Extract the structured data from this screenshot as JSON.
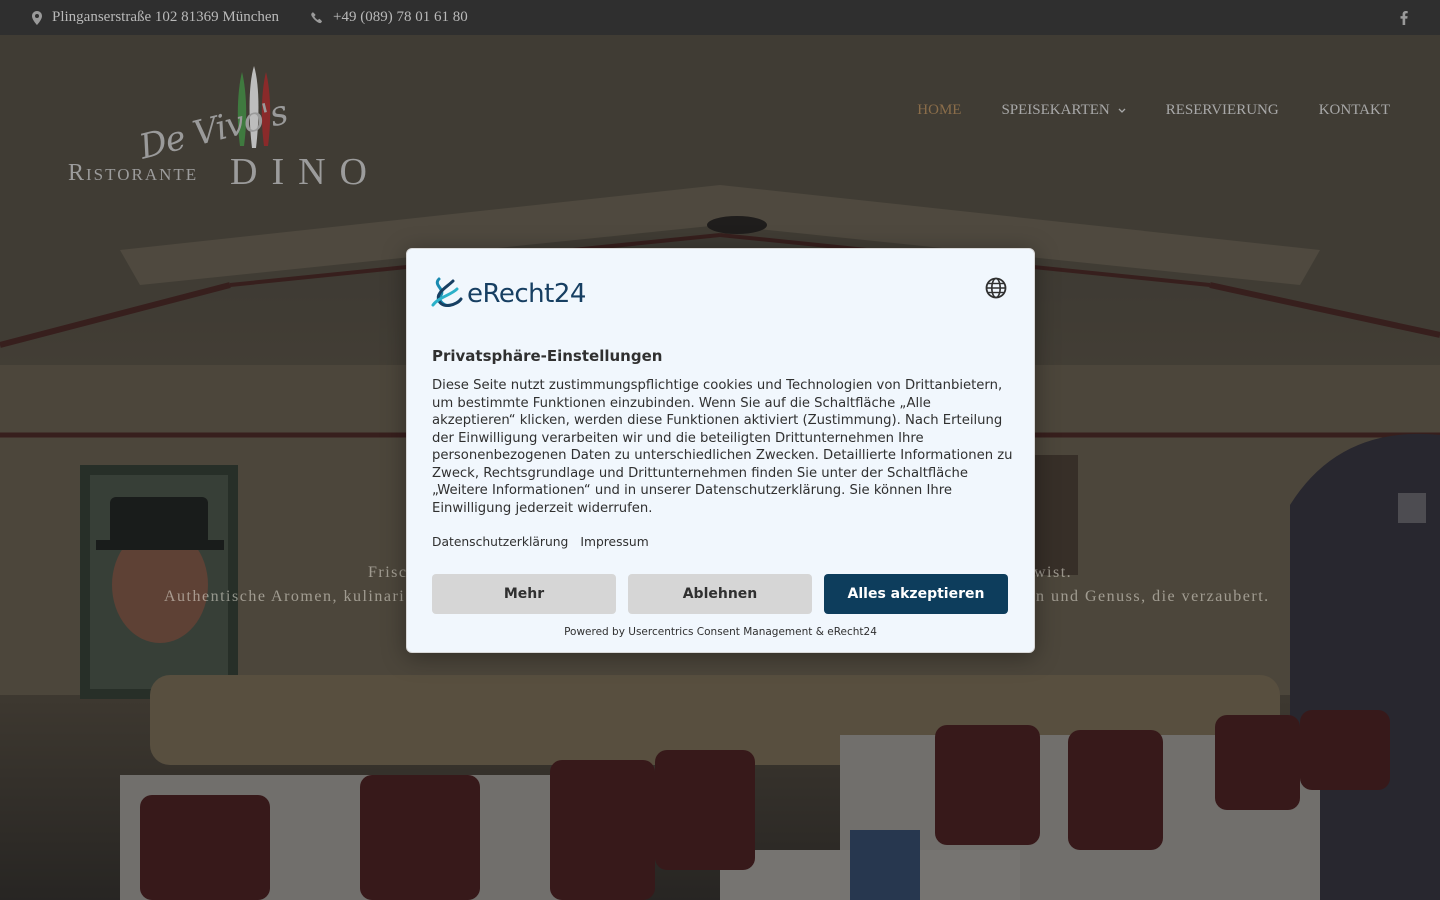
{
  "topbar": {
    "address": "Plinganserstraße 102 81369 München",
    "phone": "+49 (089) 78 01 61 80",
    "social_icon": "facebook-icon"
  },
  "logo": {
    "script_text": "De Vivo's",
    "word1": "Ristorante",
    "word2": "DINO"
  },
  "nav": {
    "items": [
      {
        "label": "HOME",
        "active": true
      },
      {
        "label": "SPEISEKARTEN",
        "has_dropdown": true
      },
      {
        "label": "RESERVIERUNG"
      },
      {
        "label": "KONTAKT"
      }
    ]
  },
  "hero": {
    "line1_left": "Frisc",
    "line1_right": "wist.",
    "line2_left": "Authentische Aromen, kulinari",
    "line2_right": "n und Genuss, die verzaubert."
  },
  "consent": {
    "brand": "eRecht24",
    "title": "Privatsphäre-Einstellungen",
    "body": "Diese Seite nutzt zustimmungspflichtige cookies und Technologien von Drittanbietern, um bestimmte Funktionen einzubinden. Wenn Sie auf die Schaltfläche „Alle akzeptieren“ klicken, werden diese Funktionen aktiviert (Zustimmung). Nach Erteilung der Einwilligung verarbeiten wir und die beteiligten Drittunternehmen Ihre personenbezogenen Daten zu unterschiedlichen Zwecken. Detaillierte Informationen zu Zweck, Rechtsgrundlage und Drittunternehmen finden Sie unter der Schaltfläche „Weitere Informationen“ und in unserer Datenschutzerklärung. Sie können Ihre Einwilligung jederzeit widerrufen.",
    "link_privacy": "Datenschutzerklärung",
    "link_imprint": "Impressum",
    "btn_more": "Mehr",
    "btn_decline": "Ablehnen",
    "btn_accept": "Alles akzeptieren",
    "powered_by": "Powered by Usercentrics Consent Management & eRecht24",
    "lang_icon": "globe-icon"
  },
  "colors": {
    "topbar_bg": "#2f2f2f",
    "nav_active": "#8a6d4a",
    "accept_button": "#0d3d5c",
    "dialog_bg": "#f1f7fd"
  }
}
